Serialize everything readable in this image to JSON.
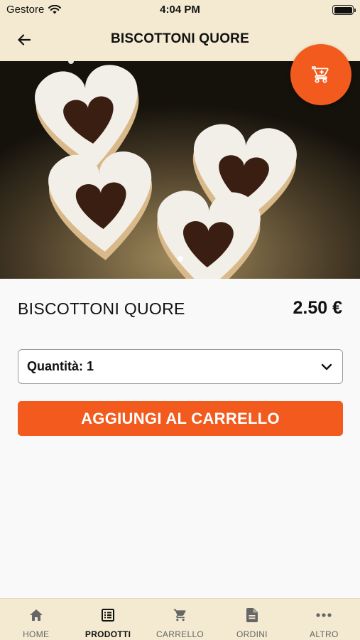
{
  "status_bar": {
    "carrier": "Gestore",
    "time": "4:04 PM"
  },
  "header": {
    "title": "BISCOTTONI QUORE"
  },
  "product": {
    "name": "BISCOTTONI QUORE",
    "price": "2.50 €",
    "quantity_label": "Quantità: 1",
    "add_to_cart_label": "AGGIUNGI AL CARRELLO"
  },
  "tabs": [
    {
      "label": "HOME",
      "icon": "home-icon",
      "active": false
    },
    {
      "label": "PRODOTTI",
      "icon": "list-icon",
      "active": true
    },
    {
      "label": "CARRELLO",
      "icon": "cart-icon",
      "active": false
    },
    {
      "label": "ORDINI",
      "icon": "document-icon",
      "active": false
    },
    {
      "label": "ALTRO",
      "icon": "more-icon",
      "active": false
    }
  ],
  "colors": {
    "accent": "#f25b1d",
    "bar_background": "#f3ead1"
  }
}
